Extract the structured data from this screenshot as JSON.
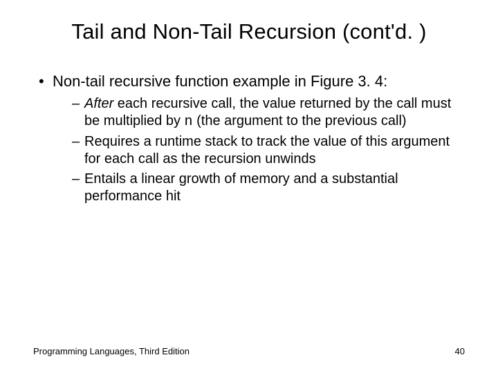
{
  "title": "Tail and Non-Tail Recursion (cont'd. )",
  "bullet1": "Non-tail recursive function example in Figure 3. 4:",
  "sub1_prefix": "After",
  "sub1_mid1": " each recursive call, the value returned by the call must be multiplied by ",
  "sub1_mono": "n",
  "sub1_tail": " (the argument to the previous call)",
  "sub2": "Requires a runtime stack to track the value of this argument for each call as the recursion unwinds",
  "sub3": "Entails a linear growth of memory and a substantial performance hit",
  "footer_left": "Programming Languages, Third Edition",
  "footer_right": "40"
}
